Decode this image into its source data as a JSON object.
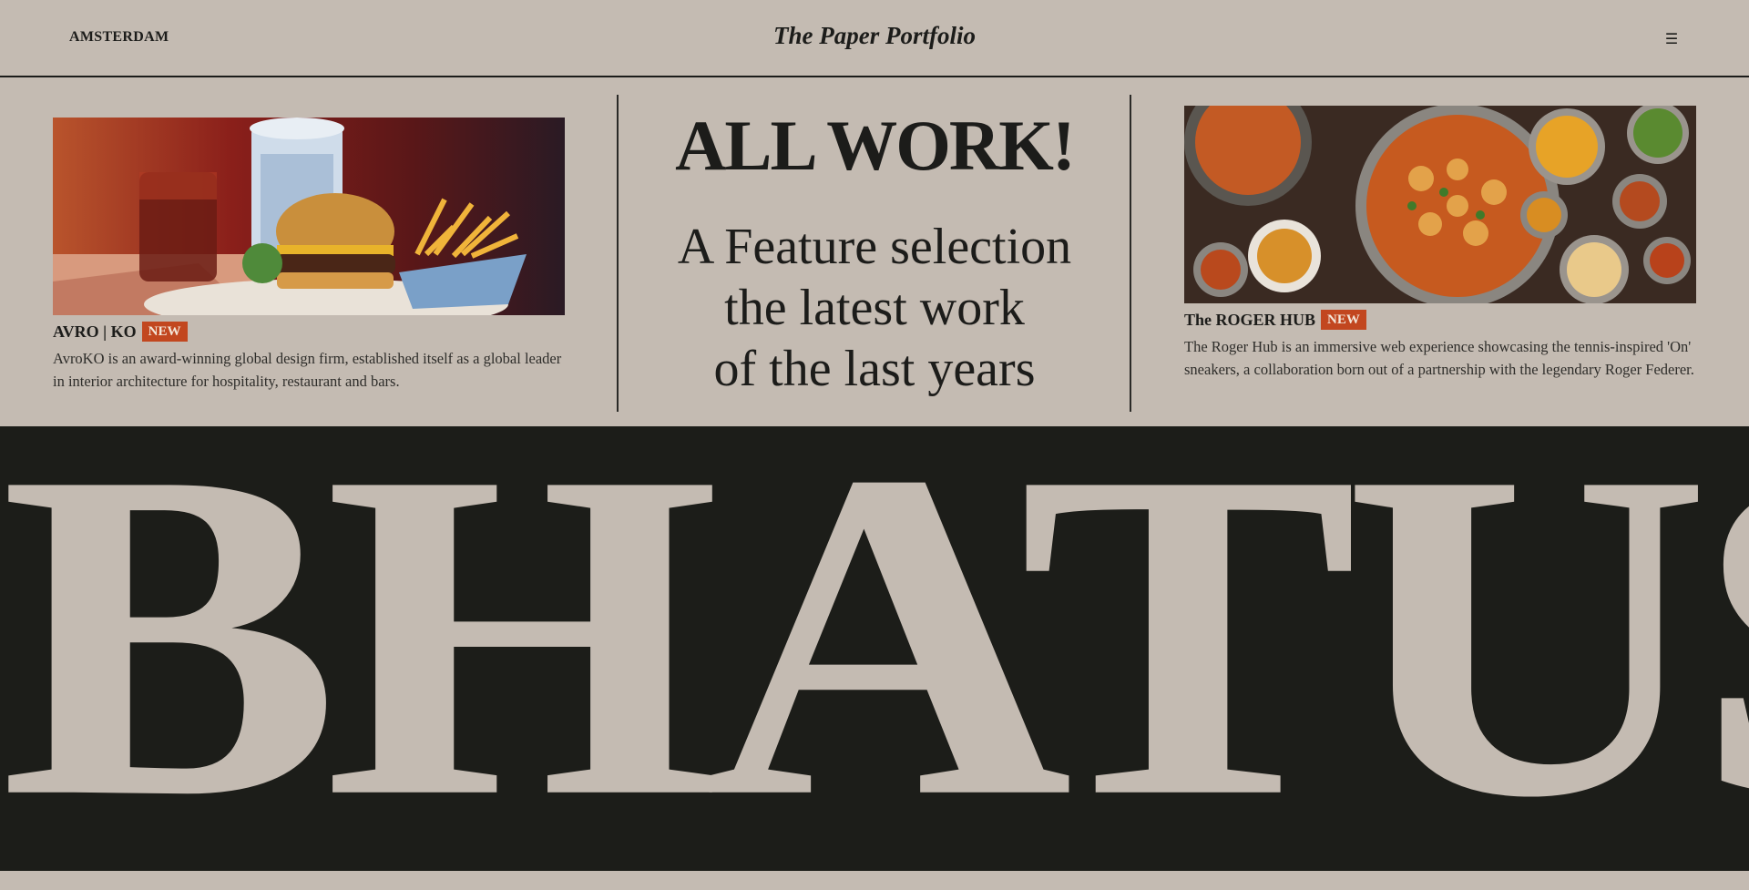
{
  "header": {
    "location": "AMSTERDAM",
    "logo": "The Paper Portfolio",
    "menu_icon": "menu-icon"
  },
  "hero": {
    "headline": "ALL WORK!",
    "subline": [
      "A Feature selection",
      "the latest work",
      "of the last years"
    ]
  },
  "projects": [
    {
      "title": "AVRO | KO",
      "badge": "NEW",
      "description": "AvroKO is an award-winning global design firm, established itself as a global leader in interior architecture for hospitality, restaurant and bars.",
      "image": "burger-fries-drinks-illustration"
    },
    {
      "title": "The ROGER HUB",
      "badge": "NEW",
      "description": "The Roger Hub is an immersive web experience showcasing the tennis-inspired 'On' sneakers, a collaboration born out of a partnership with the legendary Roger Federer.",
      "image": "indian-curry-dishes-photo"
    }
  ],
  "banner": {
    "word": "BHATUSE"
  },
  "colors": {
    "background": "#c4bbb2",
    "ink": "#1c1c1a",
    "badge": "#c2471f",
    "band": "#1c1d19"
  }
}
